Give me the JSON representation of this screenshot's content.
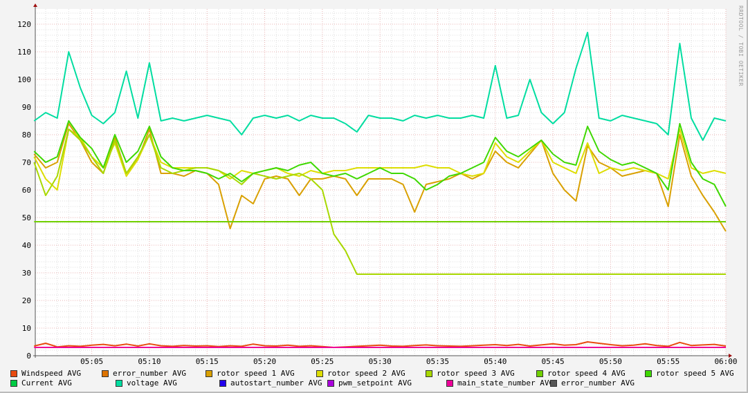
{
  "watermark": "RRDTOOL / TOBI OETIKER",
  "chart_data": {
    "type": "line",
    "title": "",
    "xlabel": "",
    "ylabel": "",
    "x_unit": "minutes after 05:00",
    "xlim": [
      0,
      60
    ],
    "ylim": [
      0,
      124
    ],
    "x_ticks": [
      {
        "t": 5,
        "label": "05:05"
      },
      {
        "t": 10,
        "label": "05:10"
      },
      {
        "t": 15,
        "label": "05:15"
      },
      {
        "t": 20,
        "label": "05:20"
      },
      {
        "t": 25,
        "label": "05:25"
      },
      {
        "t": 30,
        "label": "05:30"
      },
      {
        "t": 35,
        "label": "05:35"
      },
      {
        "t": 40,
        "label": "05:40"
      },
      {
        "t": 45,
        "label": "05:45"
      },
      {
        "t": 50,
        "label": "05:50"
      },
      {
        "t": 55,
        "label": "05:55"
      },
      {
        "t": 60,
        "label": "06:00"
      }
    ],
    "y_ticks": [
      "0",
      "10",
      "20",
      "30",
      "40",
      "50",
      "60",
      "70",
      "80",
      "90",
      "100",
      "110",
      "120"
    ],
    "grid": true,
    "legend_placement": "bottom",
    "series": [
      {
        "name": "Windspeed AVG",
        "color": "#e84a10",
        "values": [
          3.5,
          4.5,
          3.2,
          3.6,
          3.4,
          3.8,
          4.1,
          3.6,
          4.2,
          3.5,
          4.3,
          3.6,
          3.4,
          3.7,
          3.5,
          3.6,
          3.3,
          3.6,
          3.4,
          4.2,
          3.6,
          3.5,
          3.8,
          3.4,
          3.6,
          3.3,
          3.0,
          3.2,
          3.4,
          3.6,
          3.8,
          3.5,
          3.4,
          3.7,
          3.9,
          3.6,
          3.5,
          3.4,
          3.6,
          3.8,
          4.0,
          3.7,
          4.1,
          3.5,
          3.9,
          4.3,
          3.8,
          4.0,
          5.0,
          4.5,
          4.0,
          3.6,
          3.8,
          4.3,
          3.7,
          3.4,
          4.8,
          3.7,
          3.9,
          4.1,
          3.5
        ]
      },
      {
        "name": "error_number AVG",
        "color": "#dd7300",
        "values": null
      },
      {
        "name": "rotor speed 1 AVG",
        "color": "#d9a000",
        "values": [
          73,
          68,
          70,
          84,
          78,
          70,
          66,
          79,
          66,
          71,
          82,
          66,
          66,
          65,
          67,
          66,
          62,
          46,
          58,
          55,
          64,
          65,
          64,
          58,
          64,
          64,
          65,
          64,
          58,
          64,
          64,
          64,
          62,
          52,
          62,
          63,
          64,
          66,
          64,
          66,
          74,
          70,
          68,
          73,
          78,
          66,
          60,
          56,
          76,
          70,
          68,
          65,
          66,
          67,
          66,
          54,
          80,
          65,
          58,
          52,
          45
        ]
      },
      {
        "name": "rotor speed 2 AVG",
        "color": "#dddd00",
        "values": [
          72,
          64,
          60,
          82,
          79,
          72,
          68,
          77,
          65,
          71,
          80,
          70,
          68,
          68,
          68,
          68,
          67,
          64,
          67,
          66,
          67,
          68,
          66,
          65,
          67,
          66,
          67,
          67,
          68,
          68,
          68,
          68,
          68,
          68,
          69,
          68,
          68,
          66,
          65,
          66,
          77,
          72,
          70,
          74,
          78,
          70,
          68,
          66,
          77,
          66,
          68,
          67,
          68,
          67,
          66,
          64,
          82,
          68,
          66,
          67,
          66
        ]
      },
      {
        "name": "rotor speed 3 AVG",
        "color": "#a8d800",
        "values": [
          70,
          58,
          65,
          82,
          78,
          72,
          66,
          78,
          66,
          72,
          80,
          68,
          66,
          67,
          68,
          68,
          67,
          65,
          62,
          66,
          65,
          64,
          65,
          66,
          64,
          60,
          44,
          38,
          29.5,
          29.5,
          29.5,
          29.5,
          29.5,
          29.5,
          29.5,
          29.5,
          29.5,
          29.5,
          29.5,
          29.5,
          29.5,
          29.5,
          29.5,
          29.5,
          29.5,
          29.5,
          29.5,
          29.5,
          29.5,
          29.5,
          29.5,
          29.5,
          29.5,
          29.5,
          29.5,
          29.5,
          29.5,
          29.5,
          29.5,
          29.5,
          29.5
        ]
      },
      {
        "name": "rotor speed 4 AVG",
        "color": "#70d000",
        "values": [
          48.5,
          48.5,
          48.5,
          48.5,
          48.5,
          48.5,
          48.5,
          48.5,
          48.5,
          48.5,
          48.5,
          48.5,
          48.5,
          48.5,
          48.5,
          48.5,
          48.5,
          48.5,
          48.5,
          48.5,
          48.5,
          48.5,
          48.5,
          48.5,
          48.5,
          48.5,
          48.5,
          48.5,
          48.5,
          48.5,
          48.5,
          48.5,
          48.5,
          48.5,
          48.5,
          48.5,
          48.5,
          48.5,
          48.5,
          48.5,
          48.5,
          48.5,
          48.5,
          48.5,
          48.5,
          48.5,
          48.5,
          48.5,
          48.5,
          48.5,
          48.5,
          48.5,
          48.5,
          48.5,
          48.5,
          48.5,
          48.5,
          48.5,
          48.5,
          48.5,
          48.5
        ]
      },
      {
        "name": "rotor speed 5 AVG",
        "color": "#3ed800",
        "values": [
          74,
          70,
          72,
          85,
          79,
          75,
          68,
          80,
          70,
          74,
          83,
          72,
          68,
          67,
          67,
          66,
          64,
          66,
          63,
          66,
          67,
          68,
          67,
          69,
          70,
          66,
          65,
          66,
          64,
          66,
          68,
          66,
          66,
          64,
          60,
          62,
          65,
          66,
          68,
          70,
          79,
          74,
          72,
          75,
          78,
          73,
          70,
          69,
          83,
          74,
          71,
          69,
          70,
          68,
          66,
          60,
          84,
          70,
          64,
          62,
          54
        ]
      },
      {
        "name": "Current AVG",
        "color": "#00cc44",
        "values": null
      },
      {
        "name": "voltage AVG",
        "color": "#00dda0",
        "values": [
          85,
          88,
          86,
          110,
          97,
          87,
          84,
          88,
          103,
          86,
          106,
          85,
          86,
          85,
          86,
          87,
          86,
          85,
          80,
          86,
          87,
          86,
          87,
          85,
          87,
          86,
          86,
          84,
          81,
          87,
          86,
          86,
          85,
          87,
          86,
          87,
          86,
          86,
          87,
          86,
          105,
          86,
          87,
          100,
          88,
          84,
          88,
          104,
          117,
          86,
          85,
          87,
          86,
          85,
          84,
          80,
          113,
          86,
          78,
          86,
          85
        ]
      },
      {
        "name": "autostart_number AVG",
        "color": "#2200ee",
        "values": null
      },
      {
        "name": "pwm_setpoint AVG",
        "color": "#aa00dd",
        "values": null
      },
      {
        "name": "main_state_number AVG",
        "color": "#ee0099",
        "values": [
          3,
          3,
          3,
          3,
          3,
          3,
          3,
          3,
          3,
          3,
          3,
          3,
          3,
          3,
          3,
          3,
          3,
          3,
          3,
          3,
          3,
          3,
          3,
          3,
          3,
          3,
          3,
          3,
          3,
          3,
          3,
          3,
          3,
          3,
          3,
          3,
          3,
          3,
          3,
          3,
          3,
          3,
          3,
          3,
          3,
          3,
          3,
          3,
          3,
          3,
          3,
          3,
          3,
          3,
          3,
          3,
          3,
          3,
          3,
          3,
          3
        ]
      },
      {
        "name": "error_number AVG",
        "color": "#555555",
        "values": null
      }
    ]
  }
}
